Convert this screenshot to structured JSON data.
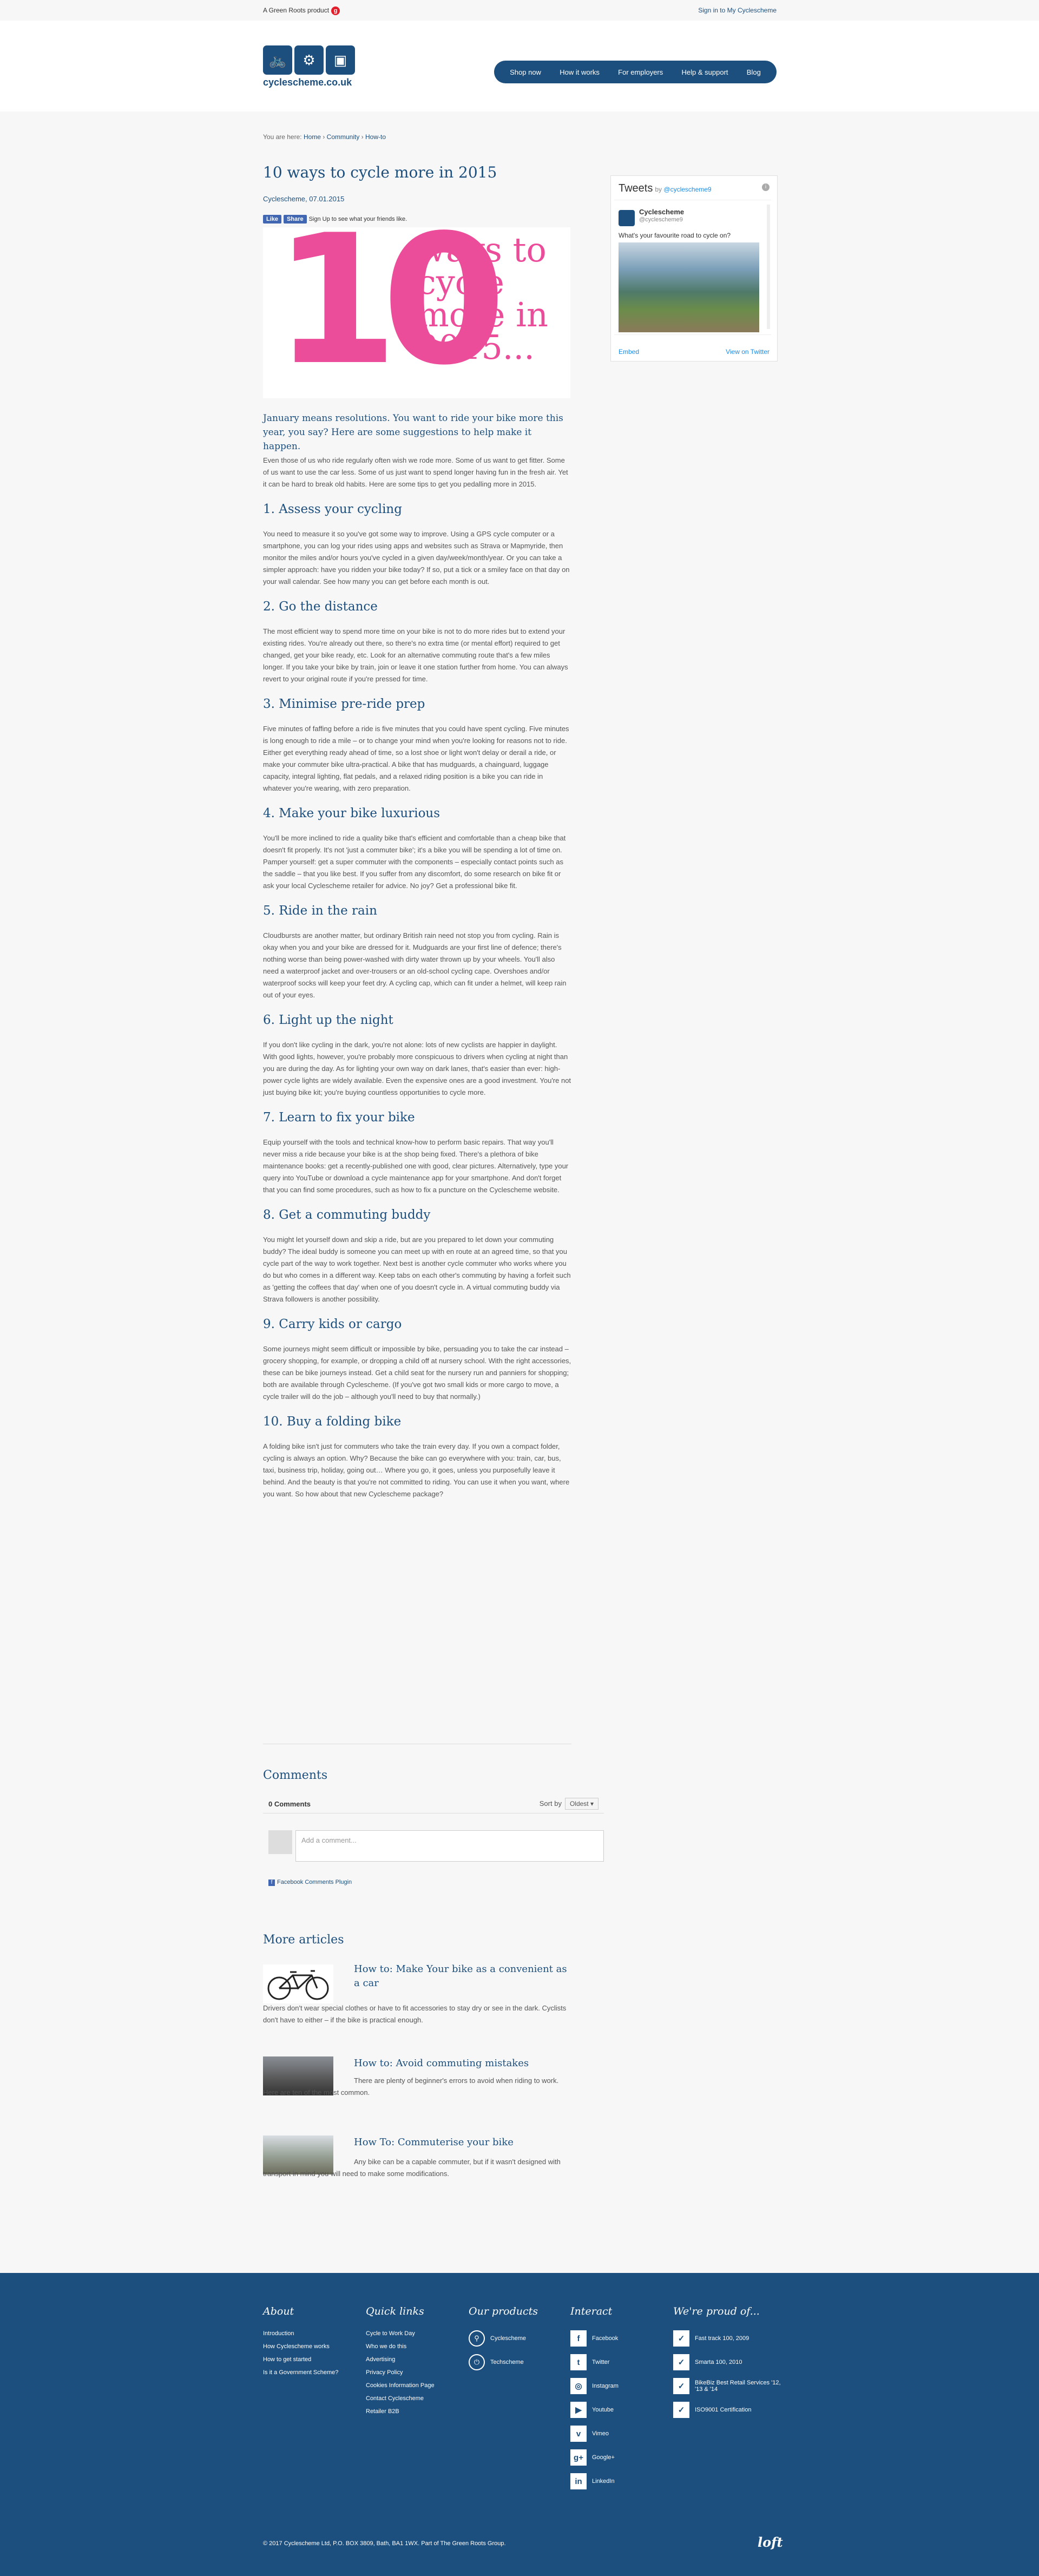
{
  "topbar": {
    "group_text": "A Green Roots product",
    "signin": "Sign in to My Cyclescheme"
  },
  "header": {
    "logo_text": "cyclescheme.co.uk",
    "nav": [
      "Shop now",
      "How it works",
      "For employers",
      "Help & support",
      "Blog"
    ]
  },
  "breadcrumb": {
    "prefix": "You are here:",
    "items": [
      "Home",
      "Community",
      "How-to"
    ]
  },
  "article": {
    "title": "10 ways to cycle more in 2015",
    "byline": "Cyclescheme, 07.01.2015",
    "fb": {
      "like": "Like",
      "share": "Share",
      "text": "Sign Up to see what your friends like."
    },
    "hero": {
      "number": "10",
      "words": [
        "ways to",
        "cycle",
        "more in",
        "2015..."
      ]
    },
    "lead": "January means resolutions. You want to ride your bike more this year, you say? Here are some suggestions to help make it happen.",
    "intro": "Even those of us who ride regularly often wish we rode more. Some of us want to get fitter. Some of us want to use the car less. Some of us just want to spend longer having fun in the fresh air. Yet it can be hard to break old habits. Here are some tips to get you pedalling more in 2015.",
    "sections": [
      {
        "heading": "1. Assess your cycling",
        "text": "You need to measure it so you've got some way to improve. Using a GPS cycle computer or a smartphone, you can log your rides using apps and websites such as Strava or Mapmyride, then monitor the miles and/or hours you've cycled in a given day/week/month/year. Or you can take a simpler approach: have you ridden your bike today? If so, put a tick or a smiley face on that day on your wall calendar. See how many you can get before each month is out."
      },
      {
        "heading": "2. Go the distance",
        "text": "The most efficient way to spend more time on your bike is not to do more rides but to extend your existing rides. You're already out there, so there's no extra time (or mental effort) required to get changed, get your bike ready, etc. Look for an alternative commuting route that's a few miles longer. If you take your bike by train, join or leave it one station further from home. You can always revert to your original route if you're pressed for time."
      },
      {
        "heading": "3. Minimise pre-ride prep",
        "text": "Five minutes of faffing before a ride is five minutes that you could have spent cycling. Five minutes is long enough to ride a mile – or to change your mind when you're looking for reasons not to ride. Either get everything ready ahead of time, so a lost shoe or light won't delay or derail a ride, or make your commuter bike ultra-practical. A bike that has mudguards, a chainguard, luggage capacity, integral lighting, flat pedals, and a relaxed riding position is a bike you can ride in whatever you're wearing, with zero preparation."
      },
      {
        "heading": "4. Make your bike luxurious",
        "text": "You'll be more inclined to ride a quality bike that's efficient and comfortable than a cheap bike that doesn't fit properly. It's not 'just a commuter bike'; it's a bike you will be spending a lot of time on. Pamper yourself: get a super commuter with the components – especially contact points such as the saddle – that you like best. If you suffer from any discomfort, do some research on bike fit or ask your local Cyclescheme retailer for advice. No joy? Get a professional bike fit."
      },
      {
        "heading": "5. Ride in the rain",
        "text": "Cloudbursts are another matter, but ordinary British rain need not stop you from cycling. Rain is okay when you and your bike are dressed for it. Mudguards are your first line of defence; there's nothing worse than being power-washed with dirty water thrown up by your wheels. You'll also need a waterproof jacket and over-trousers or an old-school cycling cape. Overshoes and/or waterproof socks will keep your feet dry. A cycling cap, which can fit under a helmet, will keep rain out of your eyes."
      },
      {
        "heading": "6. Light up the night",
        "text": "If you don't like cycling in the dark, you're not alone: lots of new cyclists are happier in daylight. With good lights, however, you're probably more conspicuous to drivers when cycling at night than you are during the day. As for lighting your own way on dark lanes, that's easier than ever: high-power cycle lights are widely available. Even the expensive ones are a good investment. You're not just buying bike kit; you're buying countless opportunities to cycle more."
      },
      {
        "heading": "7. Learn to fix your bike",
        "text": "Equip yourself with the tools and technical know-how to perform basic repairs. That way you'll never miss a ride because your bike is at the shop being fixed. There's a plethora of bike maintenance books: get a recently-published one with good, clear pictures. Alternatively, type your query into YouTube or download a cycle maintenance app for your smartphone. And don't forget that you can find some procedures, such as how to fix a puncture on the Cyclescheme website."
      },
      {
        "heading": "8. Get a commuting buddy",
        "text": "You might let yourself down and skip a ride, but are you prepared to let down your commuting buddy? The ideal buddy is someone you can meet up with en route at an agreed time, so that you cycle part of the way to work together. Next best is another cycle commuter who works where you do but who comes in a different way. Keep tabs on each other's commuting by having a forfeit such as 'getting the coffees that day' when one of you doesn't cycle in. A virtual commuting buddy via Strava followers is another possibility."
      },
      {
        "heading": "9. Carry kids or cargo",
        "text": "Some journeys might seem difficult or impossible by bike, persuading you to take the car instead – grocery shopping, for example, or dropping a child off at nursery school. With the right accessories, these can be bike journeys instead. Get a child seat for the nursery run and panniers for shopping; both are available through Cyclescheme. (If you've got two small kids or more cargo to move, a cycle trailer will do the job – although you'll need to buy that normally.)"
      },
      {
        "heading": "10. Buy a folding bike",
        "text": "A folding bike isn't just for commuters who take the train every day. If you own a compact folder, cycling is always an option. Why? Because the bike can go everywhere with you: train, car, bus, taxi, business trip, holiday, going out… Where you go, it goes, unless you purposefully leave it behind. And the beauty is that you're not committed to riding. You can use it when you want, where you want. So how about that new Cyclescheme package?"
      }
    ]
  },
  "comments": {
    "heading": "Comments",
    "count": "0 Comments",
    "sort_label": "Sort by",
    "sort_value": "Oldest ▾",
    "placeholder": "Add a comment...",
    "plugin": "Facebook Comments Plugin"
  },
  "more_articles": {
    "heading": "More articles",
    "items": [
      {
        "title": "How to: Make Your bike as a convenient as a car",
        "text": "Drivers don't wear special clothes or have to fit accessories to stay dry or see in the dark. Cyclists don't have to either – if the bike is practical enough."
      },
      {
        "title": "How to: Avoid commuting mistakes",
        "text": "There are plenty of beginner's errors to avoid when riding to work. Here are ten of the most common."
      },
      {
        "title": "How To: Commuterise your bike",
        "text": "Any bike can be a capable commuter, but if it wasn't designed with transport in mind you will need to make some modifications."
      }
    ]
  },
  "tweets": {
    "title": "Tweets",
    "by": "by",
    "handle_link": "@cyclescheme9",
    "user_name": "Cyclescheme",
    "user_handle": "@cyclescheme9",
    "text": "What's your favourite road to cycle on?",
    "embed": "Embed",
    "view": "View on Twitter"
  },
  "footer": {
    "about": {
      "title": "About",
      "links": [
        "Introduction",
        "How Cyclescheme works",
        "How to get started",
        "Is it a Government Scheme?"
      ]
    },
    "quick": {
      "title": "Quick links",
      "links": [
        "Cycle to Work Day",
        "Who we do this",
        "Advertising",
        "Privacy Policy",
        "Cookies Information Page",
        "Contact Cyclescheme",
        "Retailer B2B"
      ]
    },
    "products": {
      "title": "Our products",
      "items": [
        "Cyclescheme",
        "Techscheme"
      ]
    },
    "interact": {
      "title": "Interact",
      "items": [
        "Facebook",
        "Twitter",
        "Instagram",
        "Youtube",
        "Vimeo",
        "Google+",
        "LinkedIn"
      ]
    },
    "proud": {
      "title": "We're proud of...",
      "items": [
        "Fast track 100, 2009",
        "Smarta 100, 2010",
        "BikeBiz Best Retail Services '12, '13 & '14",
        "ISO9001 Certification"
      ]
    },
    "copyright": "© 2017 Cyclescheme Ltd, P.O. BOX 3809, Bath, BA1 1WX. Part of The Green Roots Group.",
    "loft": "loft"
  }
}
